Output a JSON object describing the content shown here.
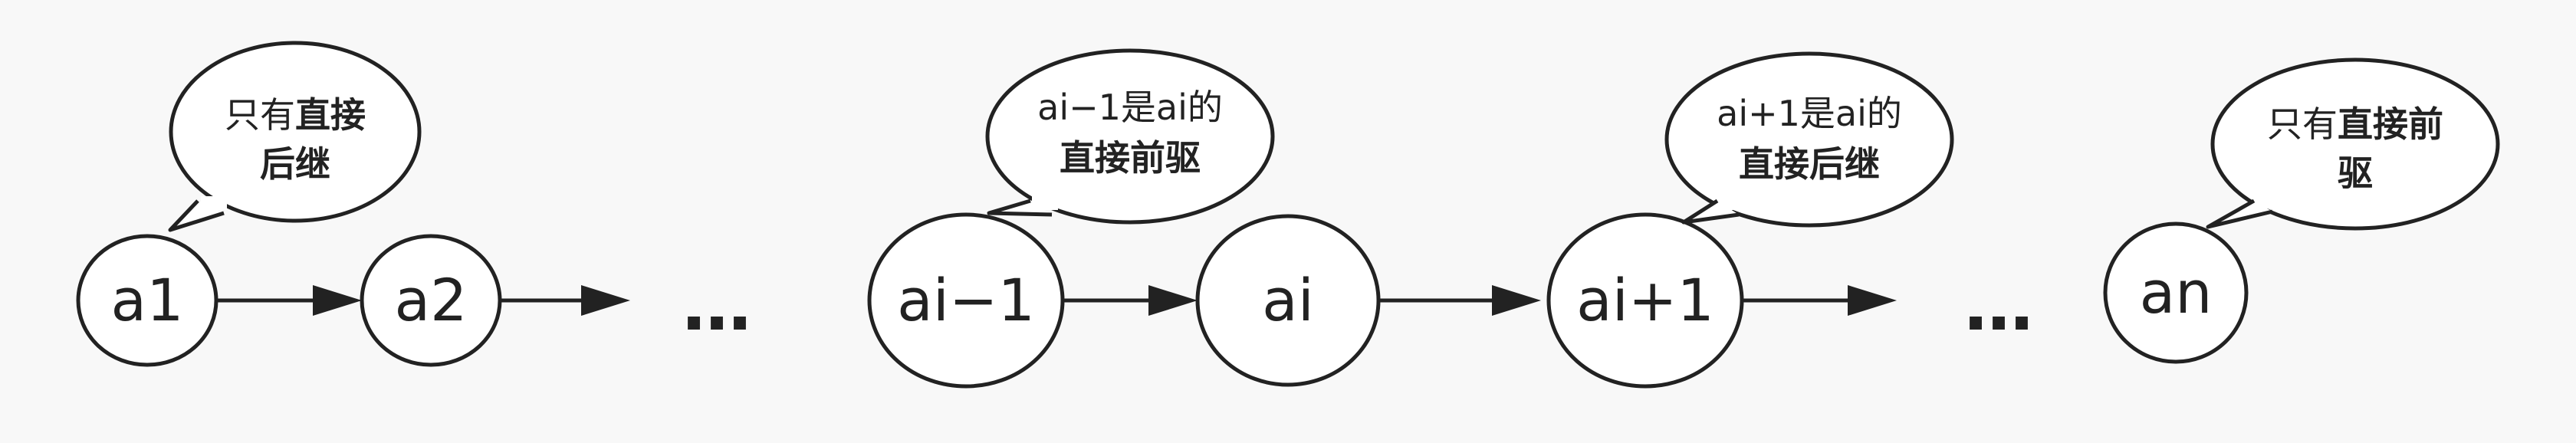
{
  "nodes": [
    {
      "id": "a1",
      "label": "a1"
    },
    {
      "id": "a2",
      "label": "a2"
    },
    {
      "id": "ai-1",
      "label": "ai−1"
    },
    {
      "id": "ai",
      "label": "ai"
    },
    {
      "id": "ai+1",
      "label": "ai+1"
    },
    {
      "id": "an",
      "label": "an"
    }
  ],
  "ellipsis": [
    "…",
    "…"
  ],
  "callouts": {
    "a1": {
      "line1_normal": "只有",
      "line1_bold": "直接",
      "line2_bold": "后继"
    },
    "ai_minus_1": {
      "line1_normal": "ai−1是ai的",
      "line2_bold": "直接前驱"
    },
    "ai_plus_1": {
      "line1_normal": "ai+1是ai的",
      "line2_bold": "直接后继"
    },
    "an": {
      "line1_normal": "只有",
      "line1_bold": "直接前",
      "line2_bold": "驱"
    }
  },
  "colors": {
    "stroke": "#222222",
    "background": "#f8f8f8",
    "fill": "#ffffff"
  }
}
